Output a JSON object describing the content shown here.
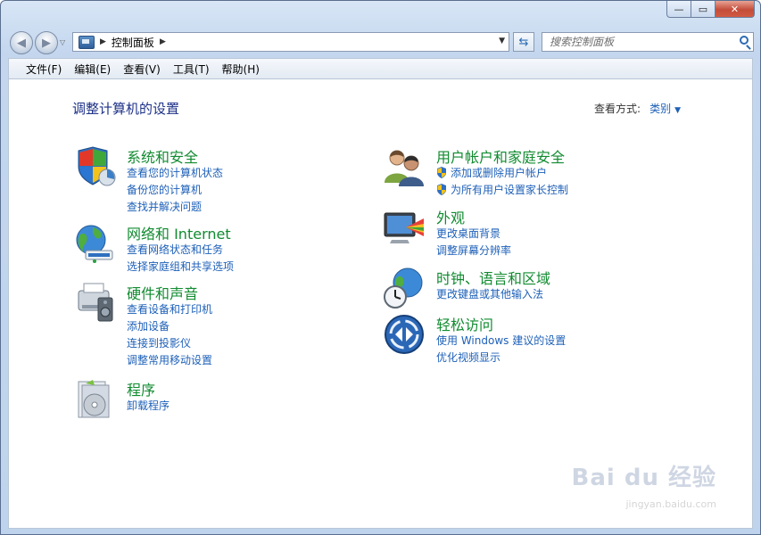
{
  "window": {
    "title_buttons": [
      "—",
      "▭",
      "✕"
    ]
  },
  "nav": {
    "breadcrumb": "控制面板",
    "search_placeholder": "搜索控制面板"
  },
  "menubar": [
    "文件(F)",
    "编辑(E)",
    "查看(V)",
    "工具(T)",
    "帮助(H)"
  ],
  "page": {
    "title": "调整计算机的设置",
    "view_by_label": "查看方式:",
    "view_by_value": "类别"
  },
  "categories_left": [
    {
      "icon": "shield-computer-icon",
      "title": "系统和安全",
      "links": [
        "查看您的计算机状态",
        "备份您的计算机",
        "查找并解决问题"
      ]
    },
    {
      "icon": "globe-network-icon",
      "title": "网络和 Internet",
      "links": [
        "查看网络状态和任务",
        "选择家庭组和共享选项"
      ]
    },
    {
      "icon": "printer-speaker-icon",
      "title": "硬件和声音",
      "links": [
        "查看设备和打印机",
        "添加设备",
        "连接到投影仪",
        "调整常用移动设置"
      ]
    },
    {
      "icon": "programs-disc-icon",
      "title": "程序",
      "links": [
        "卸载程序"
      ]
    }
  ],
  "categories_right": [
    {
      "icon": "users-icon",
      "title": "用户帐户和家庭安全",
      "links": [
        "添加或删除用户帐户",
        "为所有用户设置家长控制"
      ],
      "shielded": true
    },
    {
      "icon": "monitor-palette-icon",
      "title": "外观",
      "links": [
        "更改桌面背景",
        "调整屏幕分辨率"
      ]
    },
    {
      "icon": "clock-globe-icon",
      "title": "时钟、语言和区域",
      "links": [
        "更改键盘或其他输入法"
      ]
    },
    {
      "icon": "ease-of-access-icon",
      "title": "轻松访问",
      "links": [
        "使用 Windows 建议的设置",
        "优化视频显示"
      ]
    }
  ],
  "watermark": {
    "main": "Bai du 经验",
    "sub": "jingyan.baidu.com"
  }
}
